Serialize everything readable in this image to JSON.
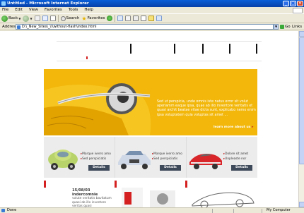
{
  "window": {
    "title": "Untitled - Microsoft Internet Explorer",
    "buttons": [
      "_",
      "□",
      "×"
    ]
  },
  "menu": [
    "File",
    "Edit",
    "View",
    "Favorites",
    "Tools",
    "Help"
  ],
  "toolbar": {
    "back_label": "Back",
    "search_label": "Search",
    "favorites_label": "Favorites"
  },
  "address": {
    "label": "Address",
    "value": "D:\\_New_Sites\\_\\\\\\without-flash\\index.html",
    "go_label": "Go",
    "links_label": "Links"
  },
  "page": {
    "hero": {
      "text": "Sed ut perspicia, unde omnis iste natus error sit volut aperiamm eaque ipsa, quae ab illo inventore veritatis et quasi archit beatae vitae dicta sunt, explicabo nemo enim ipsa voluptatem quia voluptas sit amet ...",
      "link": "learn more about us"
    },
    "cars": [
      {
        "links": [
          "Marque iverro amo",
          "Sed perspiciatis"
        ],
        "button": "Details"
      },
      {
        "links": [
          "Marque iverro amo",
          "Sed perspiciatis"
        ],
        "button": "Details"
      },
      {
        "links": [
          "Dolore sit amet",
          "Unpleaste nor"
        ],
        "button": "Details"
      }
    ],
    "news": {
      "date": "15/08/03",
      "headline": "indercomnie",
      "text": "volute veritatis bavitatum quaei ab illo inventore veritas quasi"
    }
  },
  "status": {
    "left": "Done",
    "zone": "My Computer"
  },
  "colors": {
    "hero_bg": "#f2b70a",
    "accent_red": "#d42020",
    "button_dark": "#3e4a5a",
    "titlebar": "#0a5fd8"
  }
}
